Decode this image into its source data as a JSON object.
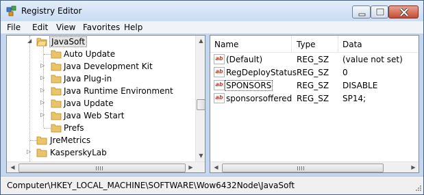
{
  "window": {
    "title": "Registry Editor"
  },
  "menu": {
    "items": [
      "File",
      "Edit",
      "View",
      "Favorites",
      "Help"
    ]
  },
  "tree": {
    "nodes": [
      {
        "label": "JavaSoft",
        "expanded": true,
        "selected": true
      },
      {
        "label": "Auto Update",
        "has_children": false
      },
      {
        "label": "Java Development Kit",
        "has_children": true
      },
      {
        "label": "Java Plug-in",
        "has_children": true
      },
      {
        "label": "Java Runtime Environment",
        "has_children": true
      },
      {
        "label": "Java Update",
        "has_children": true
      },
      {
        "label": "Java Web Start",
        "has_children": true
      },
      {
        "label": "Prefs",
        "has_children": false
      },
      {
        "label": "JreMetrics",
        "has_children": false
      },
      {
        "label": "KasperskyLab",
        "has_children": true
      }
    ]
  },
  "list": {
    "columns": [
      "Name",
      "Type",
      "Data"
    ],
    "rows": [
      {
        "name": "(Default)",
        "type": "REG_SZ",
        "data": "(value not set)",
        "icon": "string-value-icon"
      },
      {
        "name": "RegDeployStatus",
        "type": "REG_SZ",
        "data": "0",
        "icon": "string-value-icon"
      },
      {
        "name": "SPONSORS",
        "type": "REG_SZ",
        "data": "DISABLE",
        "icon": "string-value-icon",
        "focused": true
      },
      {
        "name": "sponsorsoffered",
        "type": "REG_SZ",
        "data": "SP14;",
        "icon": "string-value-icon"
      }
    ]
  },
  "status": {
    "path": "Computer\\HKEY_LOCAL_MACHINE\\SOFTWARE\\Wow6432Node\\JavaSoft"
  }
}
